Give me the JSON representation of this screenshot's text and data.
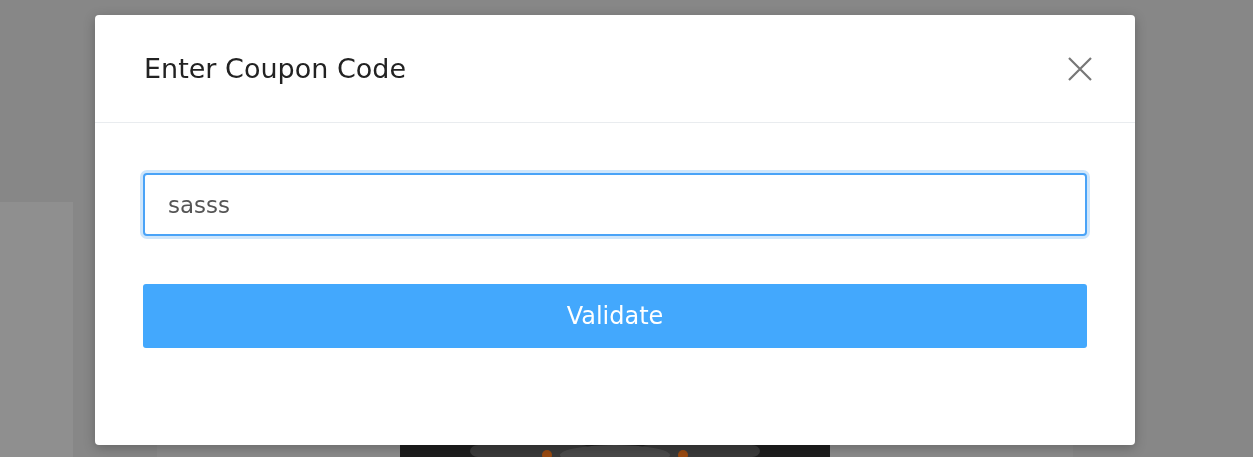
{
  "modal": {
    "title": "Enter Coupon Code",
    "coupon_field": {
      "value": "sasss",
      "focused": true
    },
    "button": {
      "label": "Validate"
    }
  }
}
